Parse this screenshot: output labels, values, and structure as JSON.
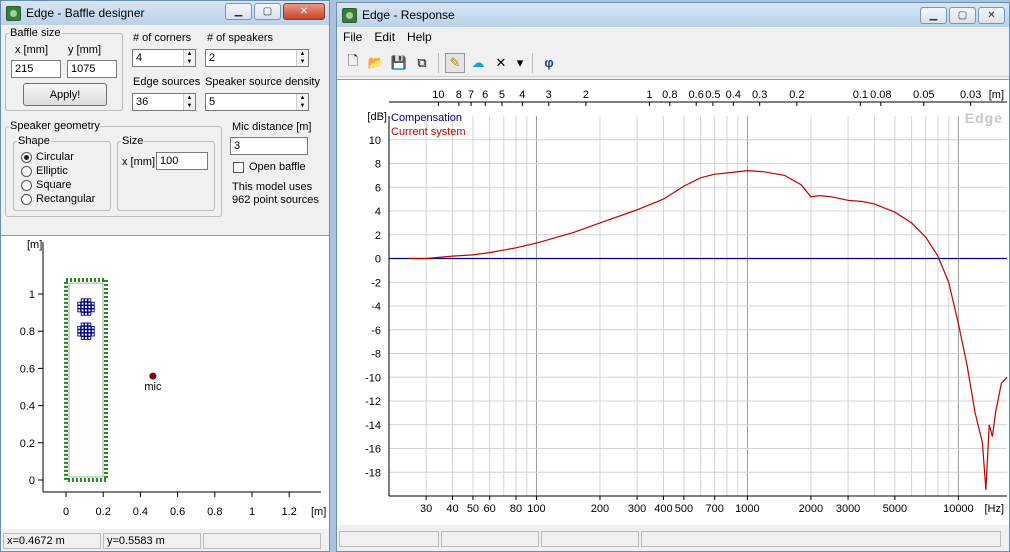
{
  "baffle_window": {
    "title": "Edge - Baffle designer",
    "baffle_size": {
      "legend": "Baffle size",
      "x_label": "x [mm]",
      "y_label": "y [mm]",
      "x_value": "215",
      "y_value": "1075",
      "apply_label": "Apply!"
    },
    "corners": {
      "label": "# of corners",
      "value": "4"
    },
    "speakers": {
      "label": "# of speakers",
      "value": "2"
    },
    "edge_sources": {
      "label": "Edge sources",
      "value": "36"
    },
    "speaker_density": {
      "label": "Speaker source density",
      "value": "5"
    },
    "speaker_geometry": {
      "legend": "Speaker geometry",
      "shape_legend": "Shape",
      "shapes": [
        "Circular",
        "Elliptic",
        "Square",
        "Rectangular"
      ],
      "selected_shape": "Circular",
      "size_legend": "Size",
      "size_label": "x [mm]",
      "size_value": "100"
    },
    "mic_distance": {
      "label": "Mic distance [m]",
      "value": "3"
    },
    "open_baffle": {
      "label": "Open baffle",
      "checked": false
    },
    "model_info": {
      "line1": "This model uses",
      "line2": "962 point sources"
    },
    "plot": {
      "y_unit": "[m]",
      "x_unit": "[m]",
      "x_ticks": [
        "0",
        "0.2",
        "0.4",
        "0.6",
        "0.8",
        "1",
        "1.2"
      ],
      "y_ticks": [
        "0",
        "0.2",
        "0.4",
        "0.6",
        "0.8",
        "1"
      ],
      "mic_label": "mic",
      "baffle_color": "#1e8c1e",
      "speaker_color": "#000080",
      "mic_color": "#8b0000"
    },
    "status": {
      "x": "x=0.4672 m",
      "y": "y=0.5583 m"
    }
  },
  "response_window": {
    "title": "Edge - Response",
    "menu": [
      "File",
      "Edit",
      "Help"
    ],
    "toolbar": [
      {
        "name": "new-file-icon",
        "glyph": "🗋"
      },
      {
        "name": "open-folder-icon",
        "glyph": "📂"
      },
      {
        "name": "save-icon",
        "glyph": "💾"
      },
      {
        "name": "copy-icon",
        "glyph": "⧉"
      },
      {
        "name": "pencil-icon",
        "glyph": "✎"
      },
      {
        "name": "network-icon",
        "glyph": "☁"
      },
      {
        "name": "delete-icon",
        "glyph": "✕"
      },
      {
        "name": "dropdown-arrow-icon",
        "glyph": "▾"
      },
      {
        "name": "phase-icon",
        "glyph": "φ"
      }
    ],
    "watermark": "Edge",
    "chart_data": {
      "type": "line",
      "xlabel": "[Hz]",
      "ylabel": "[dB]",
      "x_scale": "log",
      "xlim": [
        20,
        17000
      ],
      "ylim": [
        -20,
        12
      ],
      "grid": true,
      "legend": "top-left",
      "y_ticks": [
        10,
        8,
        6,
        4,
        2,
        0,
        -2,
        -4,
        -6,
        -8,
        -10,
        -12,
        -14,
        -16,
        -18
      ],
      "x_ticks": [
        30,
        40,
        50,
        60,
        80,
        100,
        200,
        300,
        400,
        500,
        700,
        1000,
        2000,
        3000,
        5000,
        10000
      ],
      "top_axis_unit": "[m]",
      "top_ticks": [
        "10",
        "8",
        "7",
        "6",
        "5",
        "4",
        "3",
        "2",
        "1",
        "0.8",
        "0.6",
        "0.5",
        "0.4",
        "0.3",
        "0.2",
        "0.1",
        "0.08",
        "0.05",
        "0.03"
      ],
      "top_tick_values": [
        10,
        8,
        7,
        6,
        5,
        4,
        3,
        2,
        1,
        0.8,
        0.6,
        0.5,
        0.4,
        0.3,
        0.2,
        0.1,
        0.08,
        0.05,
        0.03
      ],
      "series": [
        {
          "name": "Compensation",
          "color": "#00008b",
          "x": [
            20,
            17000
          ],
          "y": [
            0,
            0
          ]
        },
        {
          "name": "Current system",
          "color": "#c00000",
          "x": [
            25,
            30,
            40,
            50,
            60,
            80,
            100,
            150,
            200,
            300,
            400,
            500,
            600,
            700,
            800,
            1000,
            1200,
            1500,
            1800,
            2000,
            2200,
            2500,
            3000,
            3500,
            4000,
            5000,
            6000,
            7000,
            8000,
            9000,
            10000,
            11000,
            12000,
            13000,
            13500,
            14000,
            14500,
            15000,
            16000,
            17000
          ],
          "y": [
            0,
            0,
            0.2,
            0.3,
            0.5,
            0.9,
            1.3,
            2.2,
            3.0,
            4.1,
            5.0,
            6.1,
            6.8,
            7.1,
            7.2,
            7.4,
            7.3,
            7.0,
            6.2,
            5.2,
            5.3,
            5.2,
            4.9,
            4.8,
            4.6,
            3.9,
            3.0,
            1.8,
            0.2,
            -2.0,
            -5.5,
            -9.0,
            -13.0,
            -15.5,
            -19.5,
            -14.0,
            -15.0,
            -13.0,
            -10.5,
            -10.0
          ]
        }
      ]
    }
  }
}
